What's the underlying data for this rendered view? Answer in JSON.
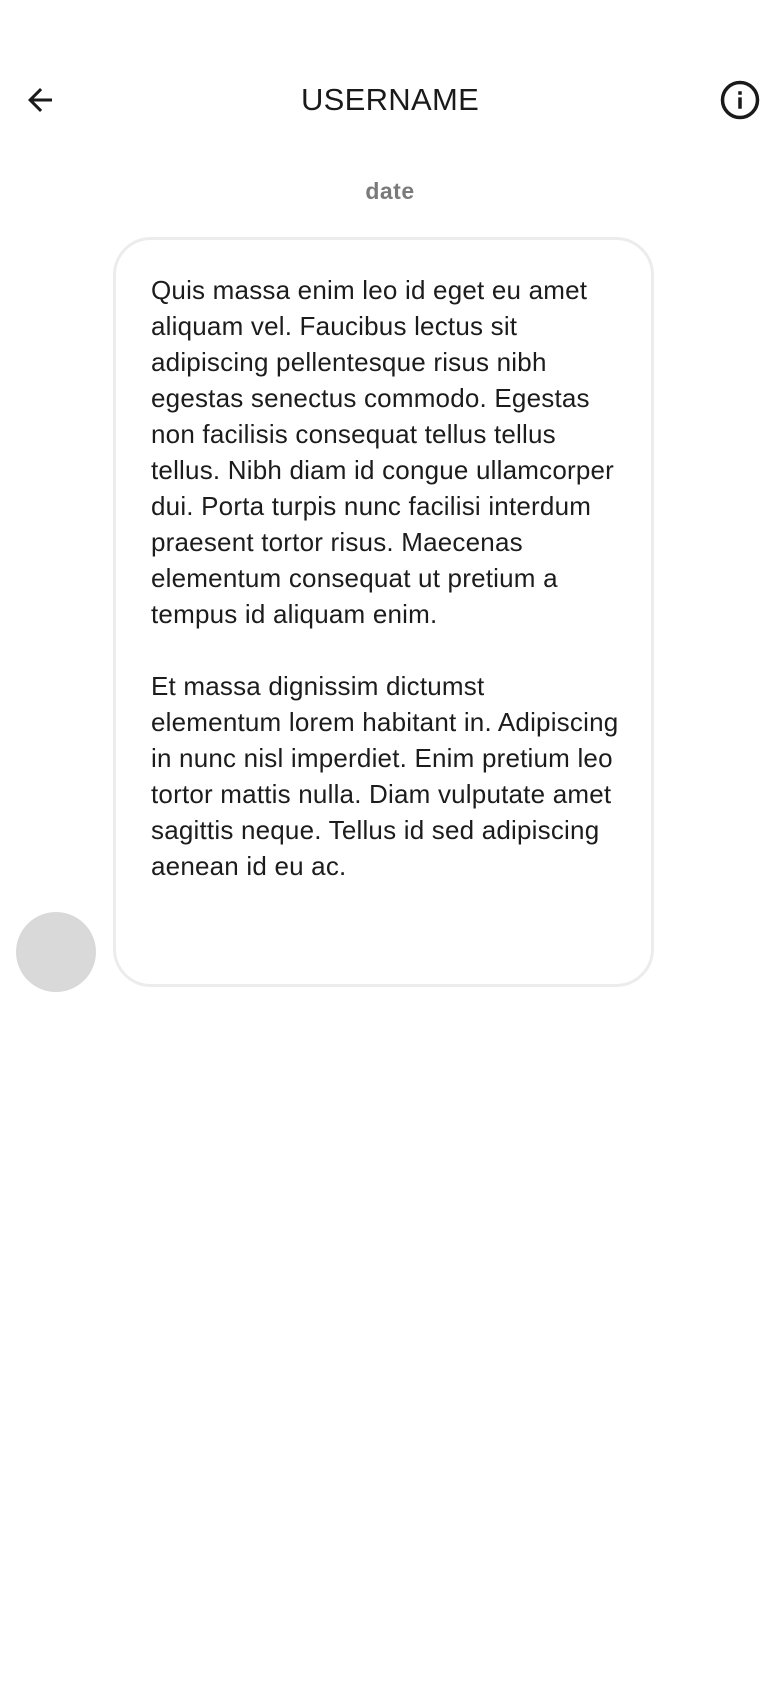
{
  "header": {
    "title": "USERNAME",
    "back_icon": "arrow-left-icon",
    "info_icon": "info-circle-icon"
  },
  "conversation": {
    "date": "date",
    "message": {
      "paragraphs": [
        "Quis massa enim leo id eget eu amet aliquam vel. Faucibus lectus sit adipiscing pellentesque risus nibh egestas senectus commodo. Egestas non facilisis consequat tellus tellus tellus. Nibh diam id congue ullamcorper dui. Porta turpis nunc facilisi interdum praesent tortor risus. Maecenas elementum consequat ut pretium a tempus id aliquam enim.",
        "Et massa dignissim dictumst elementum lorem habitant in. Adipiscing in nunc nisl imperdiet. Enim pretium leo tortor mattis nulla. Diam vulputate amet sagittis neque. Tellus id sed adipiscing aenean id eu ac."
      ]
    }
  },
  "colors": {
    "avatar_placeholder": "#d9d9d9",
    "bubble_border": "#ececec",
    "date_text": "#7a7a7a"
  }
}
